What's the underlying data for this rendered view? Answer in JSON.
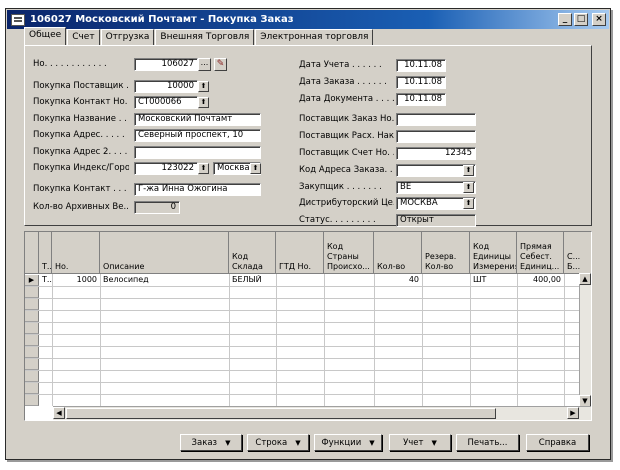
{
  "window": {
    "title": "106027 Московский Почтамт - Покупка Заказ",
    "controls": {
      "minimize": "_",
      "maximize": "□",
      "close": "×"
    }
  },
  "tabs": [
    "Общее",
    "Счет",
    "Отгрузка",
    "Внешняя Торговля",
    "Электронная торговля"
  ],
  "form": {
    "left": [
      {
        "label": "Но. . . . . . . . . . . .",
        "value": "106027"
      },
      {
        "label": "Покупка Поставщик ...",
        "value": "10000"
      },
      {
        "label": "Покупка Контакт Но. .",
        "value": "CT000066"
      },
      {
        "label": "Покупка Название . .",
        "value": "Московский Почтамт"
      },
      {
        "label": "Покупка Адрес. . . . .",
        "value": "Северный проспект, 10"
      },
      {
        "label": "Покупка Адрес 2. . . .",
        "value": ""
      },
      {
        "label": "Покупка Индекс/Город.",
        "value": "123022",
        "value2": "Москва"
      },
      {
        "label": "Покупка Контакт . . .",
        "value": "Г-жа Инна Ожогина"
      },
      {
        "label": "Кол-во Архивных Ве...",
        "value": "0"
      }
    ],
    "right": [
      {
        "label": "Дата Учета . . . . . .",
        "value": "10.11.08"
      },
      {
        "label": "Дата Заказа . . . . . .",
        "value": "10.11.08"
      },
      {
        "label": "Дата Документа . . . .",
        "value": "10.11.08"
      },
      {
        "label": "Поставщик Заказ Но. .",
        "value": ""
      },
      {
        "label": "Поставщик Расх. Нак...",
        "value": ""
      },
      {
        "label": "Поставщик Счет Но. . .",
        "value": "12345"
      },
      {
        "label": "Код Адреса Заказа. . .",
        "value": ""
      },
      {
        "label": "Закупщик . . . . . . .",
        "value": "ВЕ"
      },
      {
        "label": "Дистрибуторский Це...",
        "value": "МОСКВА"
      },
      {
        "label": "Статус. . . . . . . . .",
        "value": "Открыт"
      }
    ]
  },
  "lines": {
    "columns": [
      "Т...",
      "Но.",
      "Описание",
      "Код Склада",
      "ГТД Но.",
      "Код Страны Происхо...",
      "Кол-во",
      "Резерв. Кол-во",
      "Код Единицы Измерения",
      "Прямая Себест. Единиц...",
      "С... Б..."
    ],
    "rows": [
      [
        "Т...",
        "1000",
        "Велосипед",
        "БЕЛЫЙ",
        "",
        "",
        "40",
        "",
        "ШТ",
        "400,00",
        ""
      ]
    ]
  },
  "buttons": [
    "Заказ",
    "Строка",
    "Функции",
    "Учет",
    "Печать...",
    "Справка"
  ]
}
